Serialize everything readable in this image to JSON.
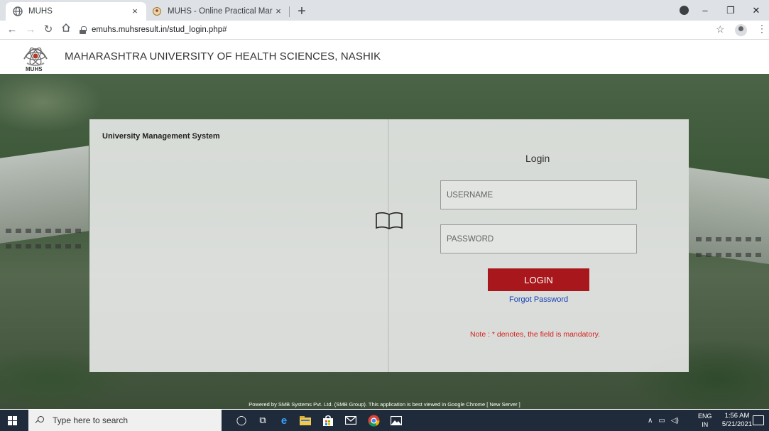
{
  "browser": {
    "tabs": [
      {
        "title": "MUHS",
        "active": true
      },
      {
        "title": "MUHS - Online Practical Marks S",
        "active": false
      }
    ],
    "new_tab_glyph": "+",
    "close_glyph": "×",
    "window_controls": {
      "minimize": "–",
      "maximize": "❐",
      "close": "✕"
    },
    "url": "emuhs.muhsresult.in/stud_login.php#"
  },
  "site": {
    "logo_text": "MUHS",
    "title": "MAHARASHTRA UNIVERSITY OF HEALTH SCIENCES, NASHIK"
  },
  "login": {
    "system_name": "University Management System",
    "heading": "Login",
    "username_placeholder": "USERNAME",
    "password_placeholder": "PASSWORD",
    "login_button": "LOGIN",
    "forgot_password": "Forgot Password",
    "note": "Note : * denotes, the field is mandatory."
  },
  "footer": {
    "powered_by": "Powered by SMB Systems Pvt. Ltd. (SMB Group). This application is best viewed in Google Chrome [ New Server ]"
  },
  "taskbar": {
    "search_placeholder": "Type here to search",
    "language": "ENG",
    "region": "IN",
    "time": "1:56 AM",
    "date": "5/21/2021"
  },
  "colors": {
    "login_button": "#a8171b",
    "note_text": "#d42020",
    "link": "#1a3fb8",
    "taskbar": "#1f2a3a"
  }
}
